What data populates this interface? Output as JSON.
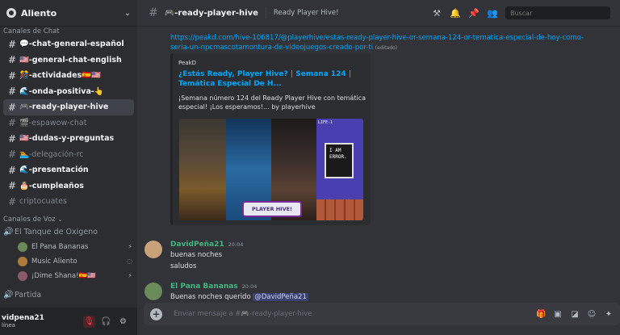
{
  "server": {
    "name": "Aliento"
  },
  "categories": {
    "chat": "Canales de Chat",
    "voice": "Canales de Voz"
  },
  "channels": [
    {
      "label": "💬-chat-general-español",
      "state": "unread"
    },
    {
      "label": "🇺🇸-general-chat-english",
      "state": "unread"
    },
    {
      "label": "🎊-actividades🇪🇸🇺🇸",
      "state": "unread"
    },
    {
      "label": "🌊-onda-positiva-👆",
      "state": "unread"
    },
    {
      "label": "🎮-ready-player-hive",
      "state": "active"
    },
    {
      "label": "🎬-espawow-chat",
      "state": "muted"
    },
    {
      "label": "🇺🇸-dudas-y-preguntas",
      "state": "unread"
    },
    {
      "label": "🏊-delegación-rc",
      "state": "muted"
    },
    {
      "label": "🌊-presentación",
      "state": "unread"
    },
    {
      "label": "🎂-cumpleaños",
      "state": "unread"
    },
    {
      "label": "criptocuates",
      "state": "muted"
    }
  ],
  "voice_channel": {
    "name": "El Tanque de Oxigeno"
  },
  "voice_users": [
    {
      "name": "El Pana Bananas",
      "color": "#6a8a5a"
    },
    {
      "name": "Music Aliento",
      "color": "#b07a3a"
    },
    {
      "name": "¡Dime Shana!🇪🇸🇺🇸",
      "color": "#8a5a6a"
    }
  ],
  "partida": "Partida",
  "user_panel": {
    "name": "vidpena21",
    "status": "línea"
  },
  "topbar": {
    "channel": "🎮-ready-player-hive",
    "topic": "Ready Player Hive!",
    "search_placeholder": "Buscar"
  },
  "link_message": {
    "url": "https://peakd.com/hive-106817/@playerhive/estas-ready-player-hive-or-semana-124-or-tematica-especial-de-hoy-como-seria-un-npcmascotamontura-de-videojuegos-creado-por-ti",
    "edited": "(editado)"
  },
  "embed": {
    "provider": "PeakD",
    "title": "¿Estás Ready, Player Hive? | Semana 124 | Temática Especial De H...",
    "description": "¡Semana número 124 del Ready Player Hive con temática especial! ¡Los esperamos!... by playerhive",
    "image_logo": "PLAYER HIVE!",
    "game_hud": "LIFE-1",
    "game_text": "I AM ERROR."
  },
  "messages": [
    {
      "author": "DavidPeña21",
      "time": "20:04",
      "author_color": "#43b581",
      "lines": [
        "buenas noches",
        "saludos"
      ]
    },
    {
      "author": "El Pana Bananas",
      "time": "20:04",
      "author_color": "#43b581",
      "text": "Buenas noches querido ",
      "mention": "@DavidPeña21"
    }
  ],
  "composer": {
    "placeholder": "Enviar mensaje a #🎮-ready-player-hive"
  }
}
